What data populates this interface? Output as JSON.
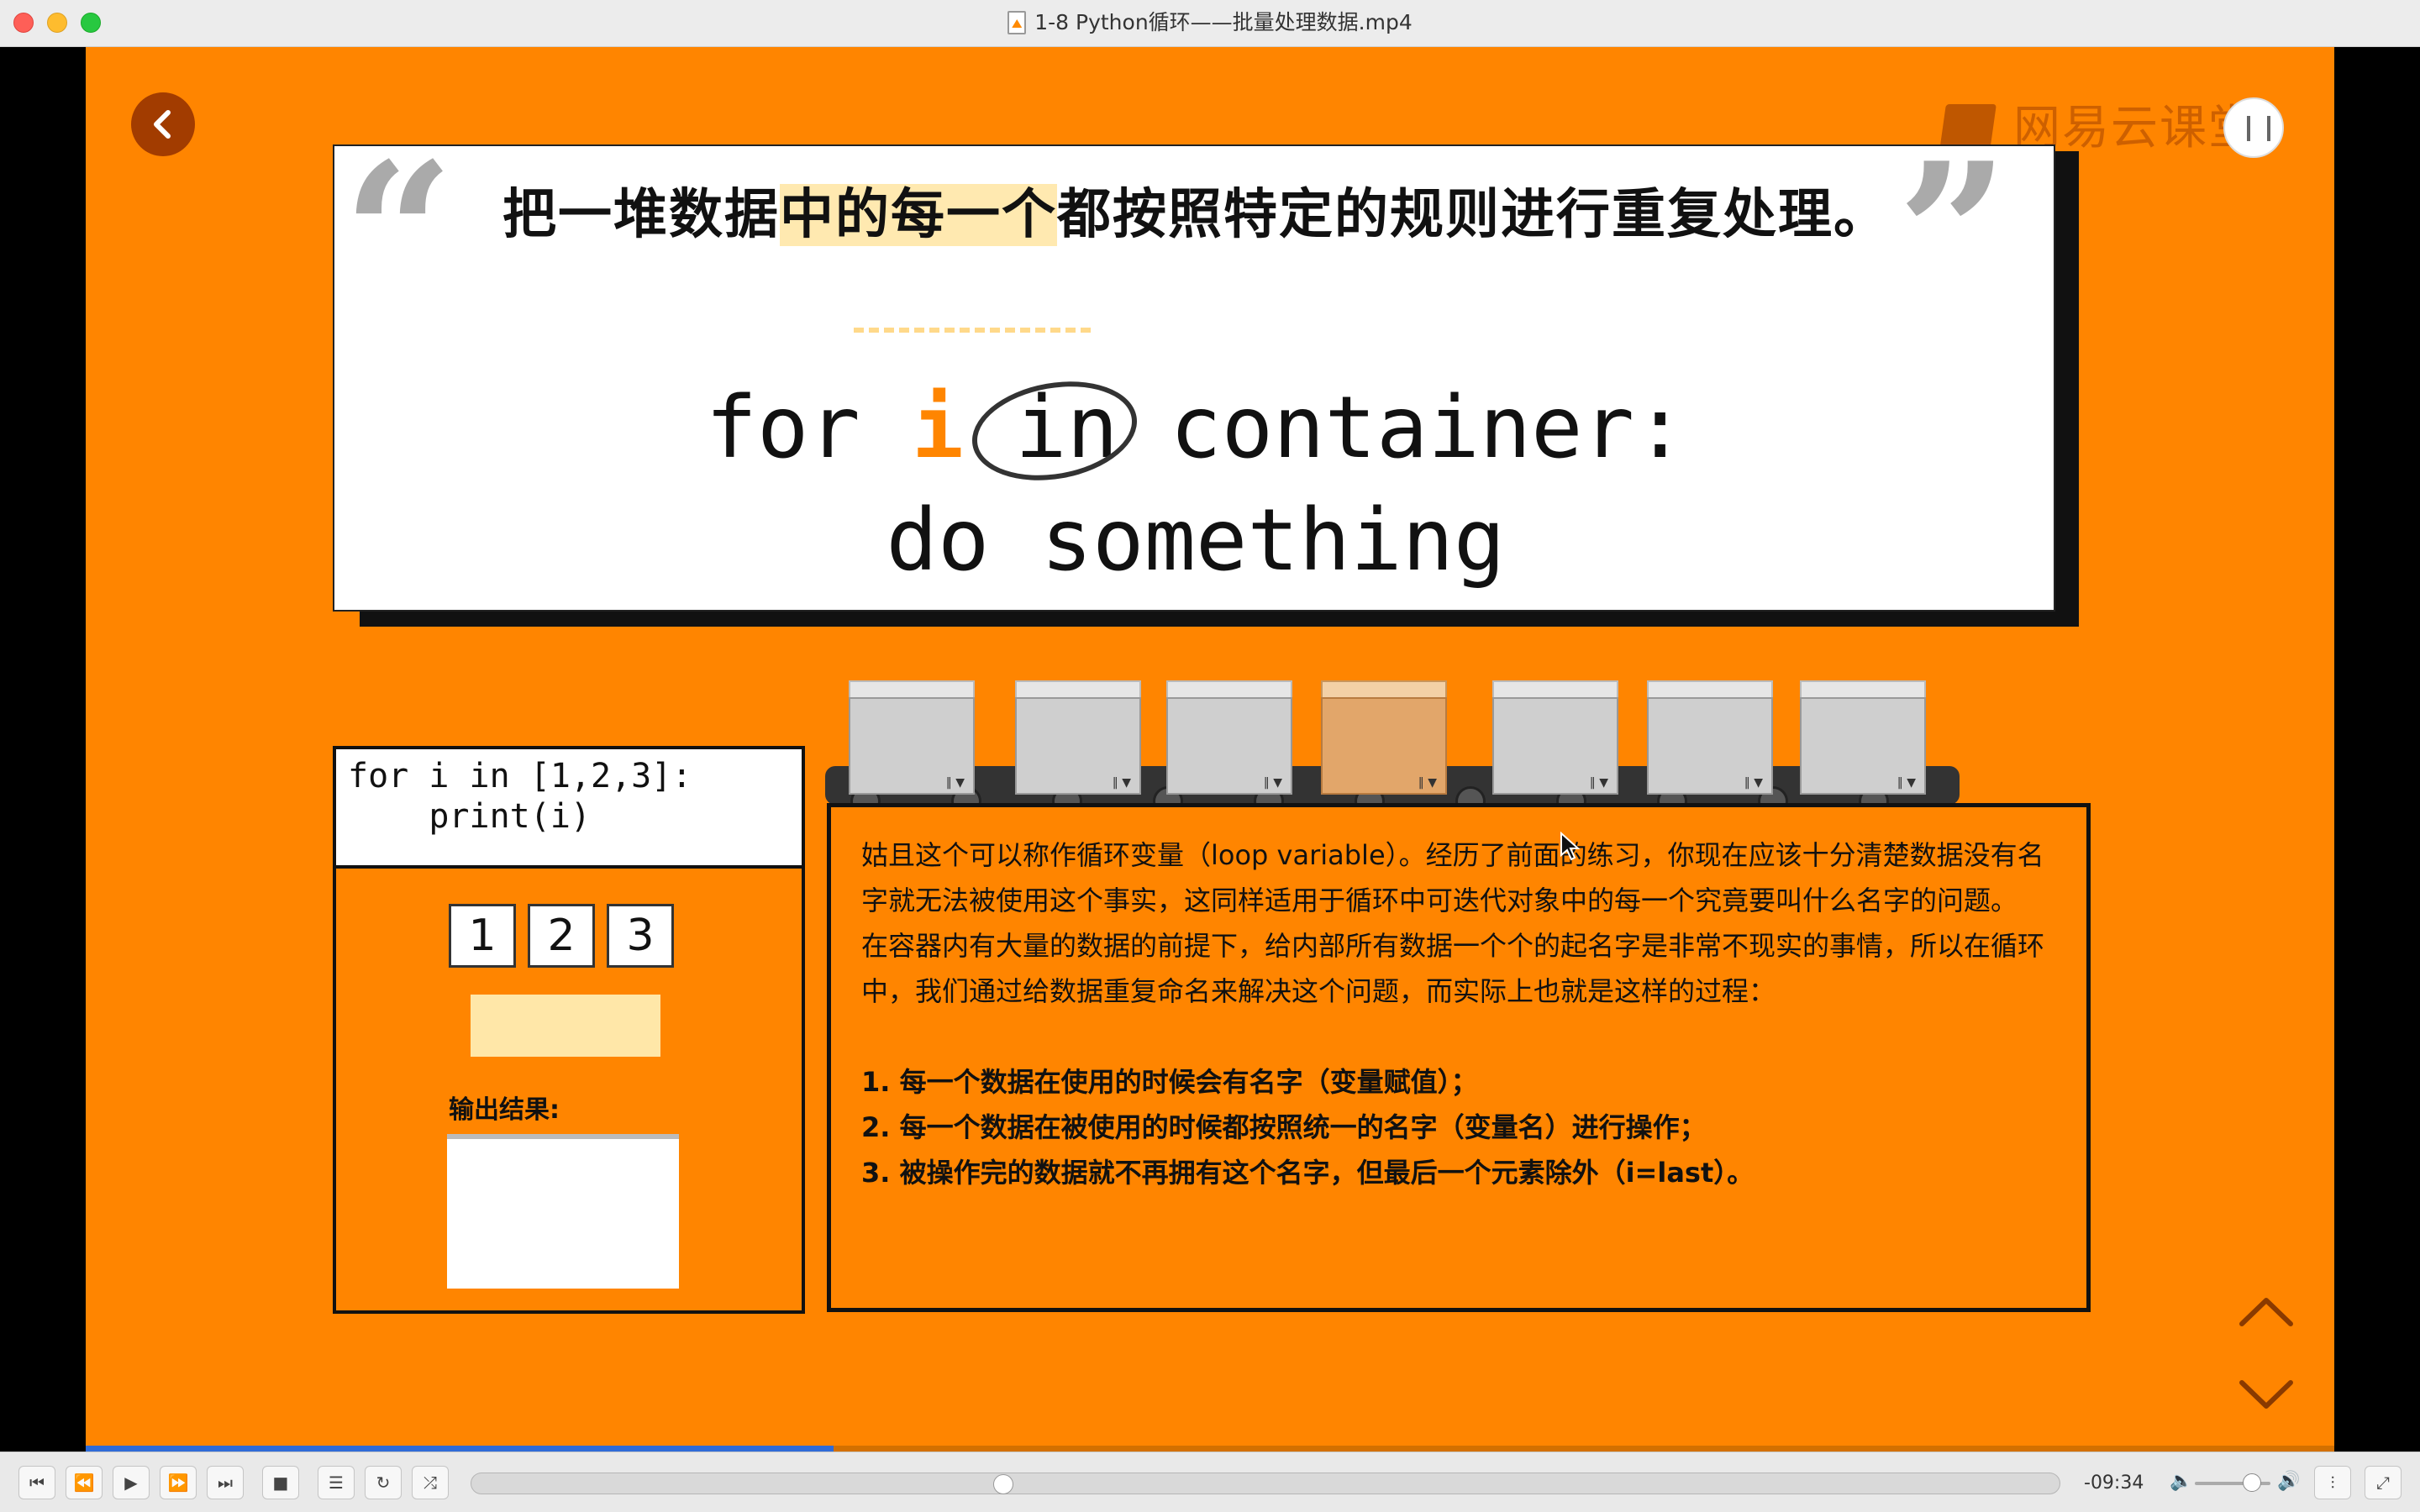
{
  "window": {
    "title": "1-8 Python循环——批量处理数据.mp4",
    "file_icon": "video-file-icon"
  },
  "slide": {
    "brand": "网易云课堂",
    "quote": {
      "text_before": "把一堆数据",
      "text_highlight": "中的每一个",
      "text_after": "都按照特定的规则进行重复处理。",
      "open_mark": "“",
      "close_mark": "”"
    },
    "syntax": {
      "kw_for": "for",
      "var": "i",
      "rest": "in container:",
      "body": "do something"
    },
    "code_example": {
      "line1": "for i in [1,2,3]:",
      "line2": "    print(i)"
    },
    "items": [
      "1",
      "2",
      "3"
    ],
    "output_label": "输出结果:",
    "explanation": {
      "para1": "姑且这个可以称作循环变量（loop variable）。经历了前面的练习，你现在应该十分清楚数据没有名字就无法被使用这个事实，这同样适用于循环中可迭代对象中的每一个究竟要叫什么名字的问题。",
      "para2": "在容器内有大量的数据的前提下，给内部所有数据一个个的起名字是非常不现实的事情，所以在循环中，我们通过给数据重复命名来解决这个问题，而实际上也就是这样的过程：",
      "points": [
        "1. 每一个数据在使用的时候会有名字（变量赋值）；",
        "2. 每一个数据在被使用的时候都按照统一的名字（变量名）进行操作；",
        "3. 被操作完的数据就不再拥有这个名字，但最后一个元素除外（i=last）。"
      ]
    }
  },
  "player": {
    "time_remaining": "-09:34",
    "progress": 0.333,
    "volume": 0.75,
    "buttons": [
      "skip-back",
      "rewind",
      "play",
      "fast-forward",
      "skip-forward",
      "stop",
      "playlist",
      "loop",
      "shuffle"
    ]
  },
  "colors": {
    "slide_bg": "#ff8500",
    "highlight": "#ffe9b0",
    "accent_var": "#ff8500"
  }
}
